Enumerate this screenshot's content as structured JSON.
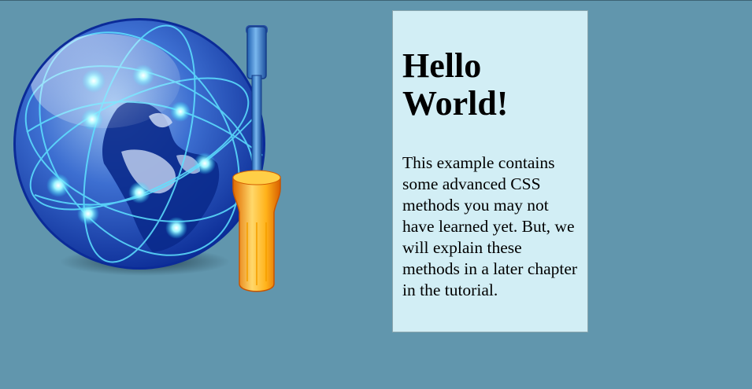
{
  "colors": {
    "page_background": "#6196ad",
    "box_background": "#d2eef5",
    "box_border": "#8aa6ae",
    "text": "#000000"
  },
  "illustration": {
    "icon": "globe-with-screwdriver-icon"
  },
  "content": {
    "heading": "Hello World!",
    "paragraph": "This example contains some advanced CSS methods you may not have learned yet. But, we will explain these methods in a later chapter in the tutorial."
  }
}
